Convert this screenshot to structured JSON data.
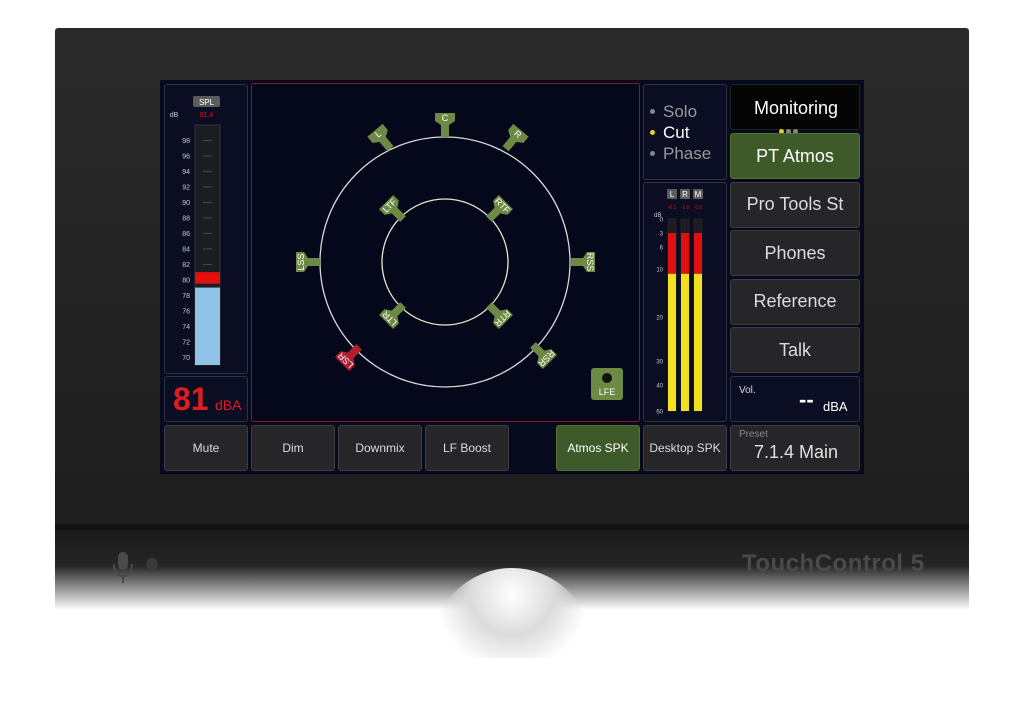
{
  "brand": "TouchControl 5",
  "spl_meter": {
    "badge": "SPL",
    "unit_label": "dB",
    "peak": "81.4",
    "ticks": [
      "98",
      "96",
      "94",
      "92",
      "90",
      "88",
      "86",
      "84",
      "82",
      "80",
      "78",
      "76",
      "74",
      "72",
      "70"
    ],
    "level": 79,
    "range": [
      69,
      100
    ],
    "red_from": 79.5,
    "red_to": 81
  },
  "spl_readout": {
    "value": "81",
    "unit": "dBA"
  },
  "speakers": [
    {
      "id": "L",
      "label": "L",
      "status": "active"
    },
    {
      "id": "C",
      "label": "C",
      "status": "active"
    },
    {
      "id": "R",
      "label": "R",
      "status": "active"
    },
    {
      "id": "LSS",
      "label": "LSS",
      "status": "active"
    },
    {
      "id": "RSS",
      "label": "RSS",
      "status": "active"
    },
    {
      "id": "LSR",
      "label": "LSR",
      "status": "cut"
    },
    {
      "id": "RSR",
      "label": "RSR",
      "status": "active"
    },
    {
      "id": "LTF",
      "label": "LTF",
      "status": "active"
    },
    {
      "id": "RTF",
      "label": "RTF",
      "status": "active"
    },
    {
      "id": "LTR",
      "label": "LTR",
      "status": "active"
    },
    {
      "id": "RTR",
      "label": "RTR",
      "status": "active"
    }
  ],
  "lfe": {
    "label": "LFE"
  },
  "modes": [
    {
      "label": "Solo",
      "active": false
    },
    {
      "label": "Cut",
      "active": true
    },
    {
      "label": "Phase",
      "active": false
    }
  ],
  "out_meter": {
    "unit_label": "dB",
    "channels": [
      {
        "label": "L",
        "peak": "-6.1",
        "level_db": 11
      },
      {
        "label": "R",
        "peak": "-1.0",
        "level_db": 11
      },
      {
        "label": "M",
        "peak": "-0.5",
        "level_db": 11
      }
    ],
    "ticks": [
      "0",
      "3",
      "6",
      "10",
      "20",
      "30",
      "40",
      "60"
    ]
  },
  "monitoring": {
    "title": "Monitoring",
    "sources": [
      {
        "label": "PT Atmos",
        "selected": true
      },
      {
        "label": "Pro Tools St",
        "selected": false
      },
      {
        "label": "Phones",
        "selected": false
      },
      {
        "label": "Reference",
        "selected": false
      },
      {
        "label": "Talk",
        "selected": false
      }
    ]
  },
  "volume": {
    "label": "Vol.",
    "value": "--",
    "unit": "dBA"
  },
  "preset": {
    "label": "Preset",
    "value": "7.1.4 Main"
  },
  "bottom_buttons": [
    {
      "label": "Mute",
      "active": false
    },
    {
      "label": "Dim",
      "active": false
    },
    {
      "label": "Downmix",
      "active": false
    },
    {
      "label": "LF Boost",
      "active": false
    }
  ],
  "speaker_sets": [
    {
      "label": "Atmos SPK",
      "active": true
    },
    {
      "label": "Desktop SPK",
      "active": false
    }
  ],
  "colors": {
    "speaker_active": "#6d8a45",
    "speaker_cut": "#b01e2f",
    "selected_green": "#3d5a28",
    "meter_blue": "#8fc3e8",
    "meter_red": "#e01010",
    "meter_yellow": "#f0e020",
    "accent_yellow": "#e8d020",
    "readout_red": "#e11b22"
  }
}
